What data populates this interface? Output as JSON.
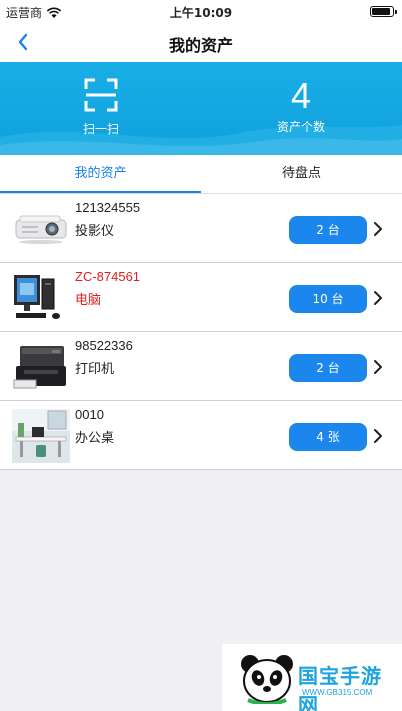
{
  "status_bar": {
    "carrier": "运营商",
    "time": "上午10:09"
  },
  "nav": {
    "title": "我的资产"
  },
  "banner": {
    "scan_label": "扫一扫",
    "asset_count": "4",
    "asset_count_label": "资产个数"
  },
  "tabs": [
    {
      "label": "我的资产",
      "active": true
    },
    {
      "label": "待盘点",
      "active": false
    }
  ],
  "assets": [
    {
      "code": "121324555",
      "name": "投影仪",
      "quantity": "2 台",
      "icon": "projector-thumbnail",
      "highlight": false
    },
    {
      "code": "ZC-874561",
      "name": "电脑",
      "quantity": "10 台",
      "icon": "computer-thumbnail",
      "highlight": true
    },
    {
      "code": "98522336",
      "name": "打印机",
      "quantity": "2 台",
      "icon": "printer-thumbnail",
      "highlight": false
    },
    {
      "code": "0010",
      "name": "办公桌",
      "quantity": "4 张",
      "icon": "office-desk-thumbnail",
      "highlight": false
    }
  ],
  "watermark": {
    "brand": "国宝手游网",
    "url": "WWW.GB315.COM"
  },
  "colors": {
    "banner": "#10a6e0",
    "accent": "#1b86ec",
    "alert": "#e02020"
  }
}
